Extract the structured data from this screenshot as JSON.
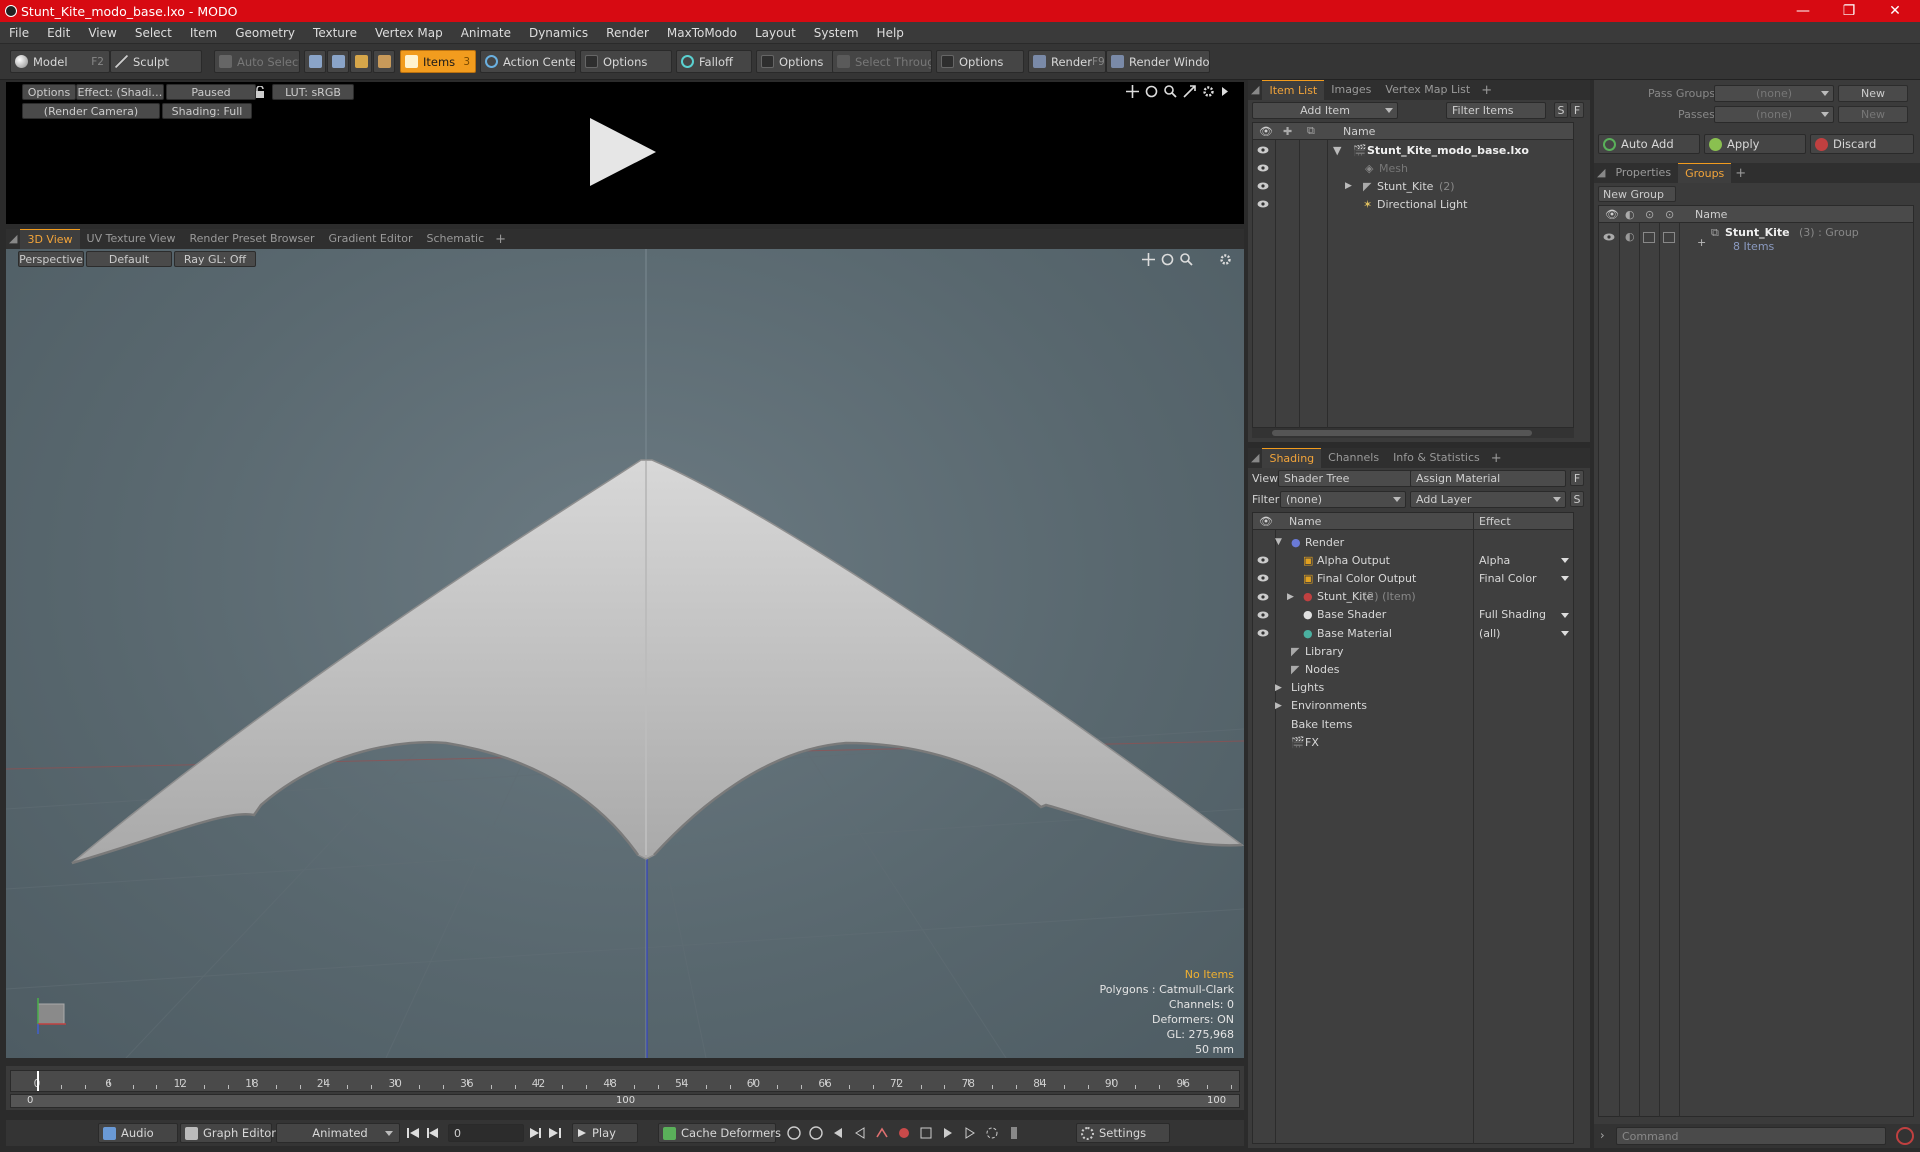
{
  "window": {
    "title": "Stunt_Kite_modo_base.lxo - MODO",
    "minimize": "—",
    "maximize": "❐",
    "close": "✕"
  },
  "menu": [
    "File",
    "Edit",
    "View",
    "Select",
    "Item",
    "Geometry",
    "Texture",
    "Vertex Map",
    "Animate",
    "Dynamics",
    "Render",
    "MaxToModo",
    "Layout",
    "System",
    "Help"
  ],
  "toolbar": {
    "model": "Model",
    "model_key": "F2",
    "sculpt": "Sculpt",
    "auto_select": "Auto Select",
    "items": "Items",
    "items_key": "3",
    "action_center": "Action Center",
    "options1": "Options",
    "falloff": "Falloff",
    "options2": "Options",
    "select_through": "Select Through",
    "options3": "Options",
    "render": "Render",
    "render_key": "F9",
    "render_window": "Render Window"
  },
  "preview": {
    "options": "Options",
    "effect": "Effect: (Shadi…",
    "paused": "Paused",
    "lut": "LUT: sRGB",
    "camera": "(Render Camera)",
    "shading": "Shading: Full"
  },
  "viewport": {
    "tabs": [
      "3D View",
      "UV Texture View",
      "Render Preset Browser",
      "Gradient Editor",
      "Schematic"
    ],
    "perspective": "Perspective",
    "default": "Default",
    "raygl": "Ray GL: Off",
    "stats": {
      "items": "No Items",
      "polygons": "Polygons : Catmull-Clark",
      "channels": "Channels: 0",
      "deformers": "Deformers: ON",
      "gl": "GL: 275,968",
      "lens": "50 mm"
    }
  },
  "item_list": {
    "tabs": [
      "Item List",
      "Images",
      "Vertex Map List"
    ],
    "add_item": "Add Item",
    "filter": "Filter Items",
    "btn_s": "S",
    "btn_f": "F",
    "col_name": "Name",
    "rows": [
      {
        "label": "Stunt_Kite_modo_base.lxo",
        "extra": ""
      },
      {
        "label": "Mesh",
        "extra": ""
      },
      {
        "label": "Stunt_Kite",
        "extra": "(2)"
      },
      {
        "label": "Directional Light",
        "extra": ""
      }
    ]
  },
  "shading": {
    "tabs": [
      "Shading",
      "Channels",
      "Info & Statistics"
    ],
    "view_label": "View",
    "view_value": "Shader Tree",
    "assign": "Assign Material",
    "btn_f": "F",
    "filter_label": "Filter",
    "filter_value": "(none)",
    "add_layer": "Add Layer",
    "btn_s": "S",
    "col_name": "Name",
    "col_effect": "Effect",
    "rows": [
      {
        "label": "Render",
        "extra": "",
        "effect": ""
      },
      {
        "label": "Alpha Output",
        "extra": "",
        "effect": "Alpha"
      },
      {
        "label": "Final Color Output",
        "extra": "",
        "effect": "Final Color"
      },
      {
        "label": "Stunt_Kite",
        "extra": "(2) (Item)",
        "effect": ""
      },
      {
        "label": "Base Shader",
        "extra": "",
        "effect": "Full Shading"
      },
      {
        "label": "Base Material",
        "extra": "",
        "effect": "(all)"
      },
      {
        "label": "Library",
        "extra": "",
        "effect": ""
      },
      {
        "label": "Nodes",
        "extra": "",
        "effect": ""
      },
      {
        "label": "Lights",
        "extra": "",
        "effect": ""
      },
      {
        "label": "Environments",
        "extra": "",
        "effect": ""
      },
      {
        "label": "Bake Items",
        "extra": "",
        "effect": ""
      },
      {
        "label": "FX",
        "extra": "",
        "effect": ""
      }
    ]
  },
  "groups_panel": {
    "pass_groups": "Pass Groups",
    "pass_groups_value": "(none)",
    "new": "New",
    "passes": "Passes",
    "passes_value": "(none)",
    "new2": "New",
    "auto_add": "Auto Add",
    "apply": "Apply",
    "discard": "Discard",
    "tabs": [
      "Properties",
      "Groups"
    ],
    "new_group": "New Group",
    "col_name": "Name",
    "group_name": "Stunt_Kite",
    "group_meta": "(3) : Group",
    "group_items": "8 Items"
  },
  "timeline": {
    "ticks": [
      0,
      6,
      12,
      18,
      24,
      30,
      36,
      42,
      48,
      54,
      60,
      66,
      72,
      78,
      84,
      90,
      96
    ],
    "range_start": "0",
    "range_mid": "100",
    "range_end": "100"
  },
  "bottom": {
    "audio": "Audio",
    "graph_editor": "Graph Editor",
    "animated": "Animated",
    "frame": "0",
    "play": "Play",
    "cache": "Cache Deformers",
    "settings": "Settings",
    "command": "Command"
  },
  "colors": {
    "title_bar": "#d70a12",
    "accent": "#f29c1e",
    "viewport_bg": "#5a6a72"
  }
}
